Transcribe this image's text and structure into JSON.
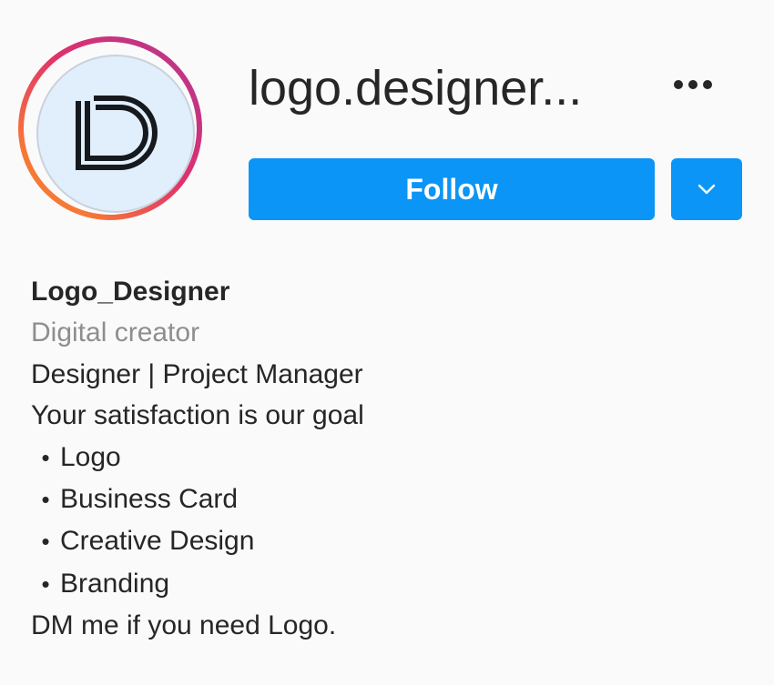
{
  "profile": {
    "username": "logo.designer...",
    "follow_label": "Follow",
    "full_name": "Logo_Designer",
    "category": "Digital creator",
    "bio_lines": [
      "Designer | Project Manager",
      "Your satisfaction is our goal"
    ],
    "bullet_symbol": "•",
    "bullets": [
      "Logo",
      "Business Card",
      "Creative Design",
      "Branding"
    ],
    "closing_line": "DM me if you need Logo."
  },
  "icons": {
    "more": "more-horizontal-icon",
    "dropdown": "chevron-down-icon",
    "avatar_logo": "ld-monogram-logo"
  },
  "colors": {
    "accent": "#0b95f6",
    "text": "#262626",
    "secondary_text": "#8e8e8e",
    "background": "#fafafa",
    "avatar_background": "#e1eefb",
    "story_ring_start": "#f58529",
    "story_ring_end": "#c13584"
  }
}
